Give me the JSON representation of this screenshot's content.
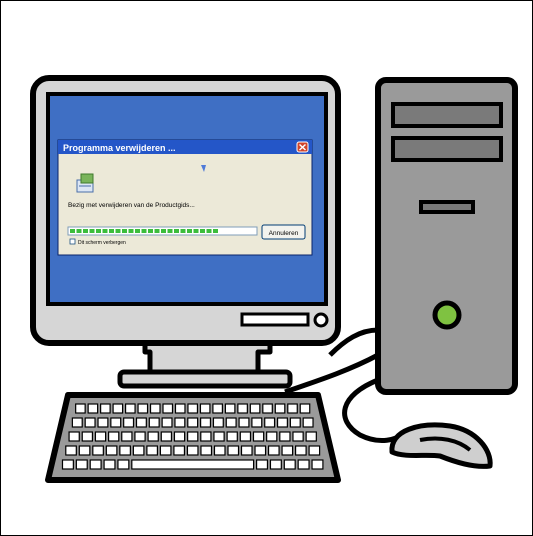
{
  "illustration": {
    "subject": "desktop-computer",
    "colors": {
      "outline": "#000000",
      "monitor_body": "#d6d6d6",
      "screen": "#3f6fc4",
      "tower": "#9a9a9a",
      "drive_bay": "#7a7a7a",
      "power_led": "#7fc241",
      "keyboard": "#9a9a9a",
      "mouse": "#cfcfcf"
    }
  },
  "dialog": {
    "title": "Programma verwijderen ...",
    "message": "Bezig met verwijderen van de Productgids...",
    "cancel_label": "Annuleren",
    "checkbox_label": "Dit scherm verbergen",
    "progress": 0.83,
    "colors": {
      "titlebar": "#2456c8",
      "close": "#d2452b",
      "body": "#ece9d8",
      "progress_fill": "#3cbd3c"
    }
  }
}
